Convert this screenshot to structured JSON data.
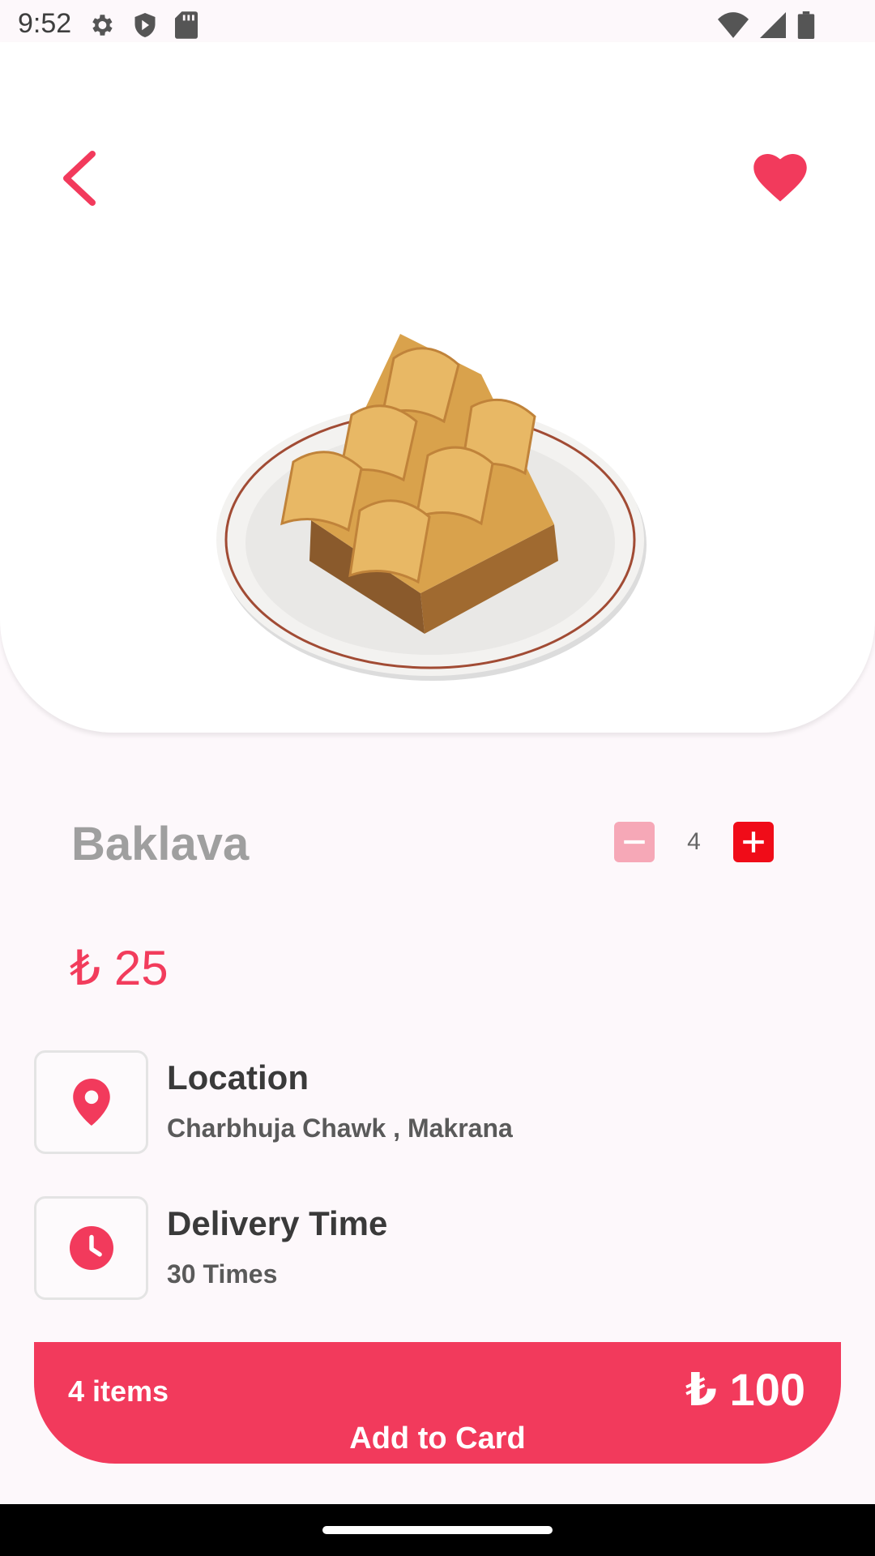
{
  "status_bar": {
    "time": "9:52",
    "icons": [
      "settings-icon",
      "shield-icon",
      "sd-card-icon",
      "wifi-icon",
      "signal-icon",
      "battery-icon"
    ]
  },
  "product": {
    "name": "Baklava",
    "price": "₺ 25",
    "quantity": "4",
    "image": "baklava-plate-image"
  },
  "details": [
    {
      "title": "Location",
      "subtitle": "Charbhuja Chawk , Makrana",
      "icon": "location-pin-icon"
    },
    {
      "title": "Delivery Time",
      "subtitle": "30 Times",
      "icon": "clock-icon"
    }
  ],
  "cart": {
    "items": "4 items",
    "total": "₺ 100",
    "action": "Add to Card"
  },
  "colors": {
    "accent": "#f23a5c",
    "plus_button": "#f00c18",
    "minus_button": "#f6a8b7",
    "background": "#fdf8fb"
  }
}
